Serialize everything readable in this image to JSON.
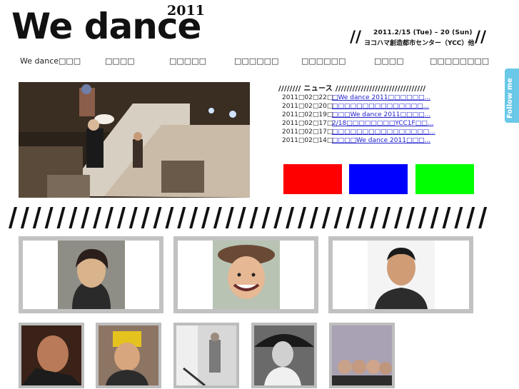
{
  "logo": {
    "title": "We dance",
    "year": "2011"
  },
  "event": {
    "slashes": "//",
    "date": "2011.2/15 (Tue) – 20 (Sun)",
    "venue": "ヨコハマ創造都市センター（YCC）他"
  },
  "nav": {
    "items": [
      "We dance□□□",
      "□□□□",
      "□□□□□",
      "□□□□□□",
      "□□□□□□",
      "□□□□",
      "□□□□□□□□"
    ]
  },
  "news": {
    "heading": "//////// ニュース ////////////////////////////////",
    "items": [
      {
        "date": "2011□02□22□",
        "title": "□We dance 2011□□□□□□..."
      },
      {
        "date": "2011□02□20□",
        "title": "□□□□□□□□□□□□□□□..."
      },
      {
        "date": "2011□02□19□",
        "title": "□□□We dance 2011□□□□..."
      },
      {
        "date": "2011□02□17□",
        "title": "2/18□□□□□□□□YCC1F□□..."
      },
      {
        "date": "2011□02□17□",
        "title": "□□□□□□□□□□□□□□□□..."
      },
      {
        "date": "2011□02□14□",
        "title": "□□□□We dance 2011□□□..."
      }
    ]
  },
  "color_boxes": [
    "#ff0000",
    "#0000ff",
    "#00ff00"
  ],
  "divider": "////////////////////////////////////////",
  "follow": {
    "label": "Follow me"
  }
}
